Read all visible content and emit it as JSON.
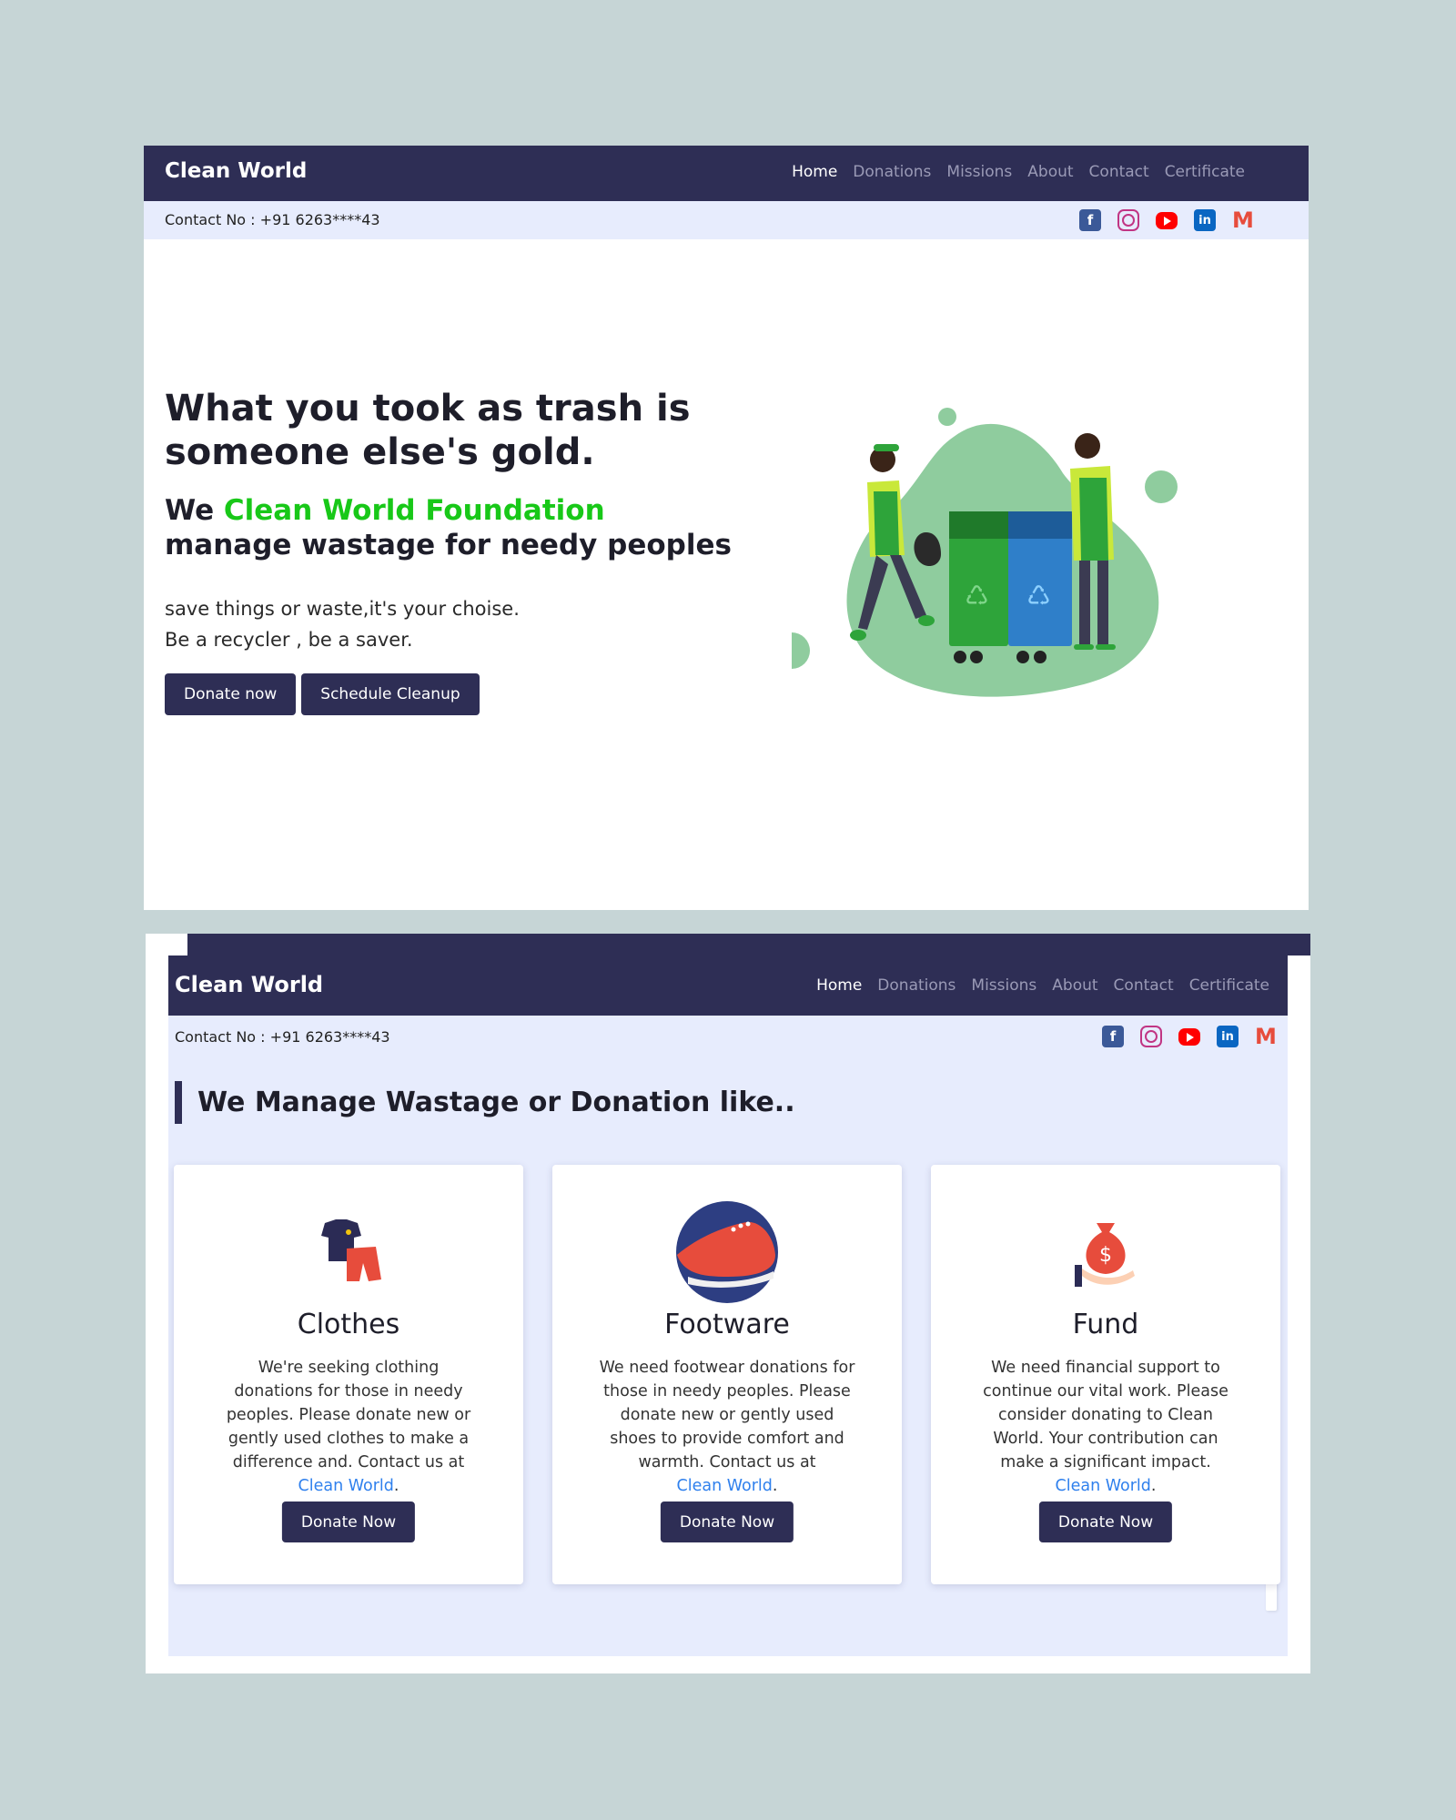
{
  "screen1": {
    "brand": "Clean World",
    "nav": [
      "Home",
      "Donations",
      "Missions",
      "About",
      "Contact",
      "Certificate"
    ],
    "contact": "Contact No : +91 6263****43",
    "socials": [
      "facebook-icon",
      "instagram-icon",
      "youtube-icon",
      "linkedin-icon",
      "gmail-icon"
    ],
    "hero": {
      "title": "What you took as trash is someone else's gold.",
      "subtitle_prefix": "We ",
      "subtitle_highlight": "Clean World Foundation",
      "subtitle_suffix": "manage wastage for needy peoples",
      "line1": "save things or waste,it's your choise.",
      "line2": "Be a recycler , be a saver.",
      "btn_donate": "Donate now",
      "btn_schedule": "Schedule Cleanup"
    }
  },
  "screen2": {
    "brand": "Clean World",
    "nav": [
      "Home",
      "Donations",
      "Missions",
      "About",
      "Contact",
      "Certificate"
    ],
    "contact": "Contact No : +91 6263****43",
    "heading": "We Manage Wastage or Donation like..",
    "cards": [
      {
        "icon": "clothes-icon",
        "title": "Clothes",
        "desc": "We're seeking clothing donations for those in needy peoples. Please donate new or gently used clothes to make a difference and. Contact us at",
        "link": "Clean World",
        "btn": "Donate Now"
      },
      {
        "icon": "footwear-icon",
        "title": "Footware",
        "desc": "We need footwear donations for those in needy peoples. Please donate new or gently used shoes to provide comfort and warmth. Contact us at",
        "link": "Clean World",
        "btn": "Donate Now"
      },
      {
        "icon": "money-bag-icon",
        "title": "Fund",
        "desc": "We need financial support to continue our vital work. Please consider donating to Clean World. Your contribution can make a significant impact.",
        "link": "Clean World",
        "btn": "Donate Now"
      }
    ]
  },
  "colors": {
    "page_bg": "#c6d5d6",
    "navbar": "#2e2e55",
    "contact_bar": "#e7ecfd",
    "highlight_green": "#18c818",
    "link_blue": "#2f80ed"
  }
}
